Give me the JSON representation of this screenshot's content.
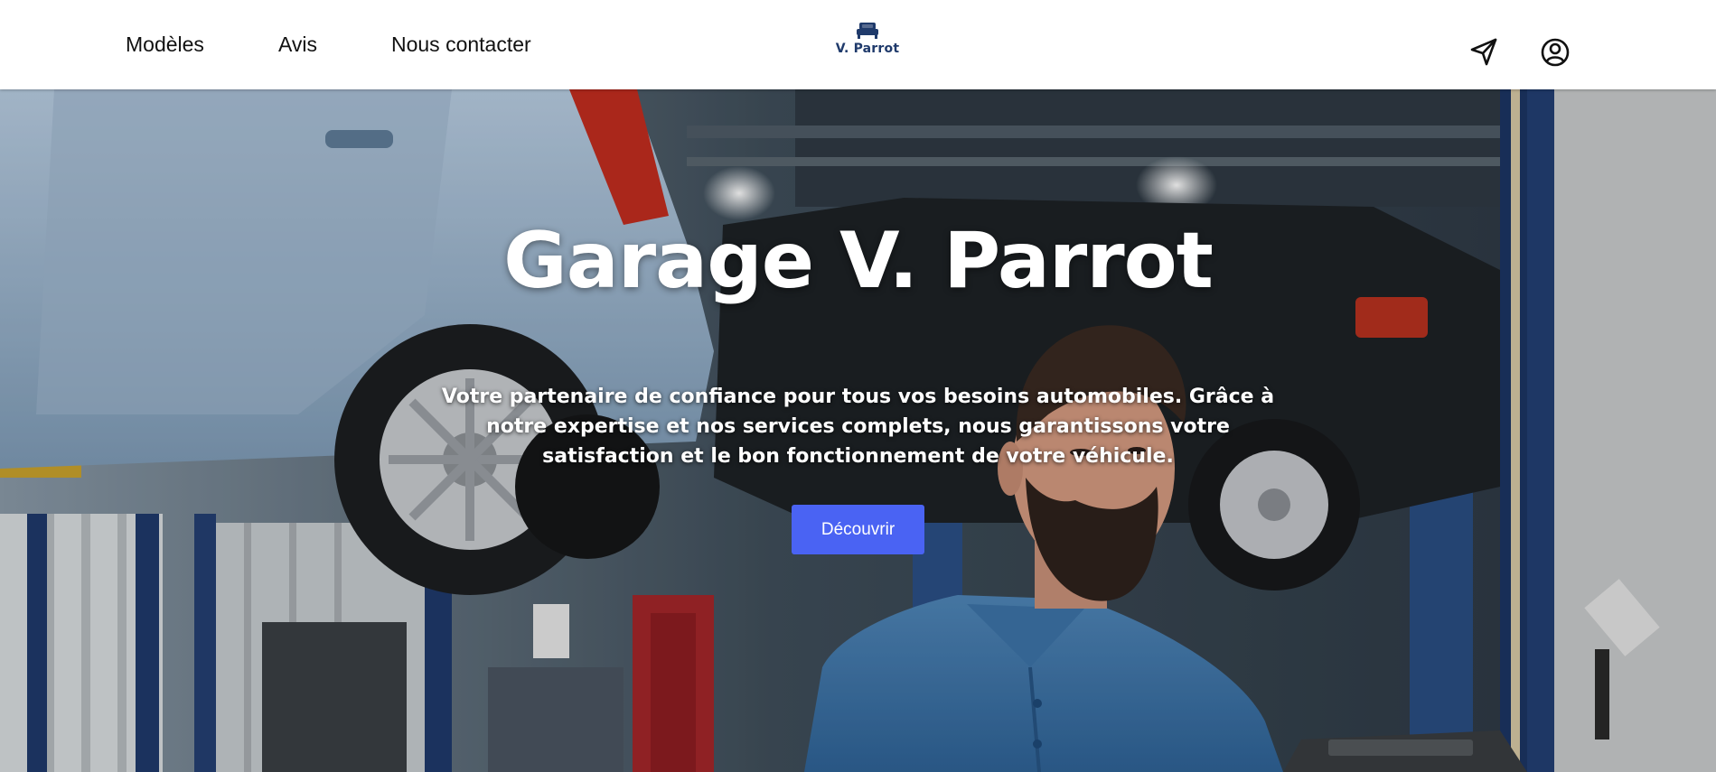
{
  "nav": {
    "items": [
      "Modèles",
      "Avis",
      "Nous contacter"
    ]
  },
  "logo": {
    "text": "V. Parrot",
    "icon": "car-seat-icon",
    "color": "#1f3a6b"
  },
  "header_icons": {
    "location": "send-arrow-icon",
    "account": "user-circle-icon"
  },
  "hero": {
    "title": "Garage V. Parrot",
    "subtitle": "Votre partenaire de confiance pour tous vos besoins automobiles. Grâce à notre expertise et nos services complets, nous garantissons votre satisfaction et le bon fonctionnement de votre véhicule.",
    "button_label": "Découvrir",
    "button_color": "#4a63f3"
  }
}
